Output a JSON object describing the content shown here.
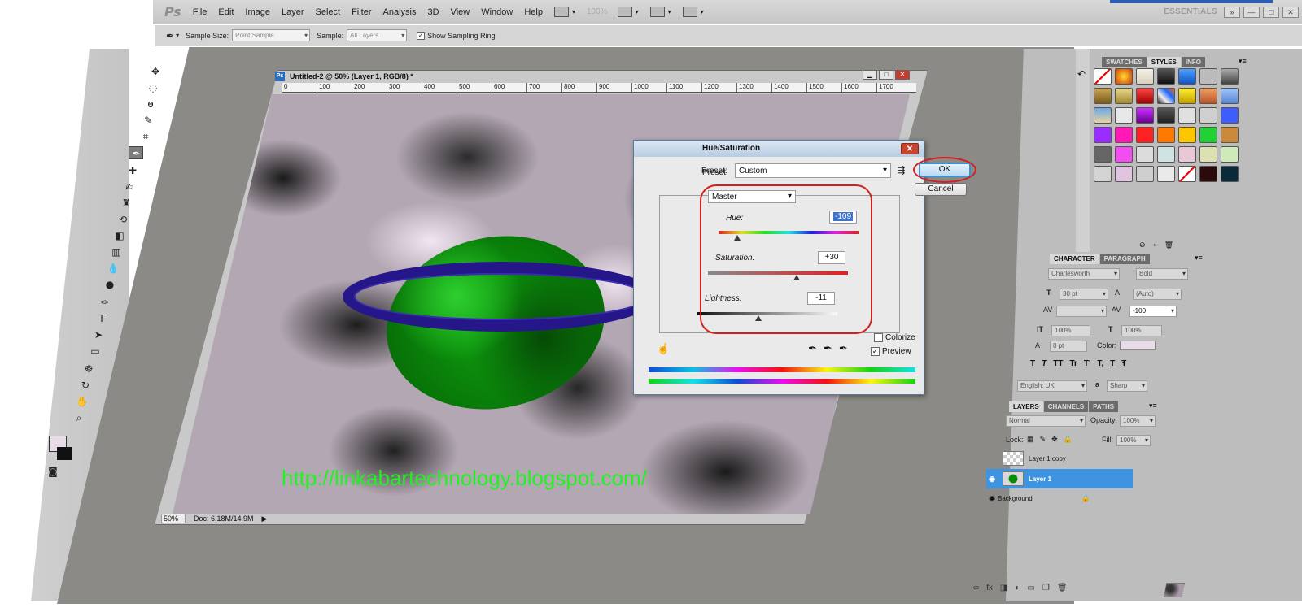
{
  "app": {
    "logo": "Ps",
    "menu": [
      "File",
      "Edit",
      "Image",
      "Layer",
      "Select",
      "Filter",
      "Analysis",
      "3D",
      "View",
      "Window",
      "Help"
    ],
    "zoom_readout": "100%",
    "workspace": "ESSENTIALS",
    "window_buttons": [
      "—",
      "□",
      "✕"
    ]
  },
  "options_bar": {
    "sample_size_label": "Sample Size:",
    "sample_size_value": "Point Sample",
    "sample_label": "Sample:",
    "sample_value": "All Layers",
    "sampling_ring_label": "Show Sampling Ring",
    "sampling_ring_checked": "✓"
  },
  "document": {
    "badge": "Ps",
    "title": "Untitled-2 @ 50% (Layer 1, RGB/8) *",
    "ruler_ticks": [
      "0",
      "100",
      "200",
      "300",
      "400",
      "500",
      "600",
      "700",
      "800",
      "900",
      "1000",
      "1100",
      "1200",
      "1300",
      "1400",
      "1500",
      "1600",
      "1700"
    ],
    "status_zoom": "50%",
    "status_doc": "Doc: 6.18M/14.9M",
    "controls": [
      "▁",
      "□",
      "✕"
    ]
  },
  "watermark": "http://linkabartechnology.blogspot.com/",
  "dialog": {
    "title": "Hue/Saturation",
    "close": "✕",
    "preset_label": "Preset:",
    "preset_value": "Custom",
    "ok_label": "OK",
    "cancel_label": "Cancel",
    "channel": "Master",
    "hue_label": "Hue:",
    "hue_value": "-109",
    "saturation_label": "Saturation:",
    "saturation_value": "+30",
    "lightness_label": "Lightness:",
    "lightness_value": "-11",
    "colorize_label": "Colorize",
    "preview_label": "Preview",
    "preview_checked": "✓",
    "colorize_checked": false
  },
  "panels": {
    "top_tabs": [
      "SWATCHES",
      "STYLES",
      "INFO"
    ],
    "char_tabs": [
      "CHARACTER",
      "PARAGRAPH"
    ],
    "font_family": "Charlesworth",
    "font_style": "Bold",
    "font_size": "30 pt",
    "leading": "(Auto)",
    "tracking": "-100",
    "vscale": "100%",
    "hscale": "100%",
    "baseline": "0 pt",
    "color_label": "Color:",
    "language": "English: UK",
    "aa_label": "a",
    "antialias": "Sharp",
    "style_glyphs": [
      "T",
      "T",
      "TT",
      "Tr",
      "T'",
      "T,",
      "T",
      "Ŧ"
    ],
    "layers_tabs": [
      "LAYERS",
      "CHANNELS",
      "PATHS"
    ],
    "blend_mode": "Normal",
    "opacity_label": "Opacity:",
    "opacity": "100%",
    "lock_label": "Lock:",
    "fill_label": "Fill:",
    "fill": "100%",
    "layers": [
      {
        "name": "Layer 1 copy",
        "selected": false
      },
      {
        "name": "Layer 1",
        "selected": true
      },
      {
        "name": "Background",
        "selected": false
      }
    ]
  },
  "colors": {
    "highlight": "#d41f1f",
    "selected_layer": "#3e94e0",
    "watermark": "#21f221",
    "planet": "#0fa30f",
    "ring": "#25178a"
  }
}
